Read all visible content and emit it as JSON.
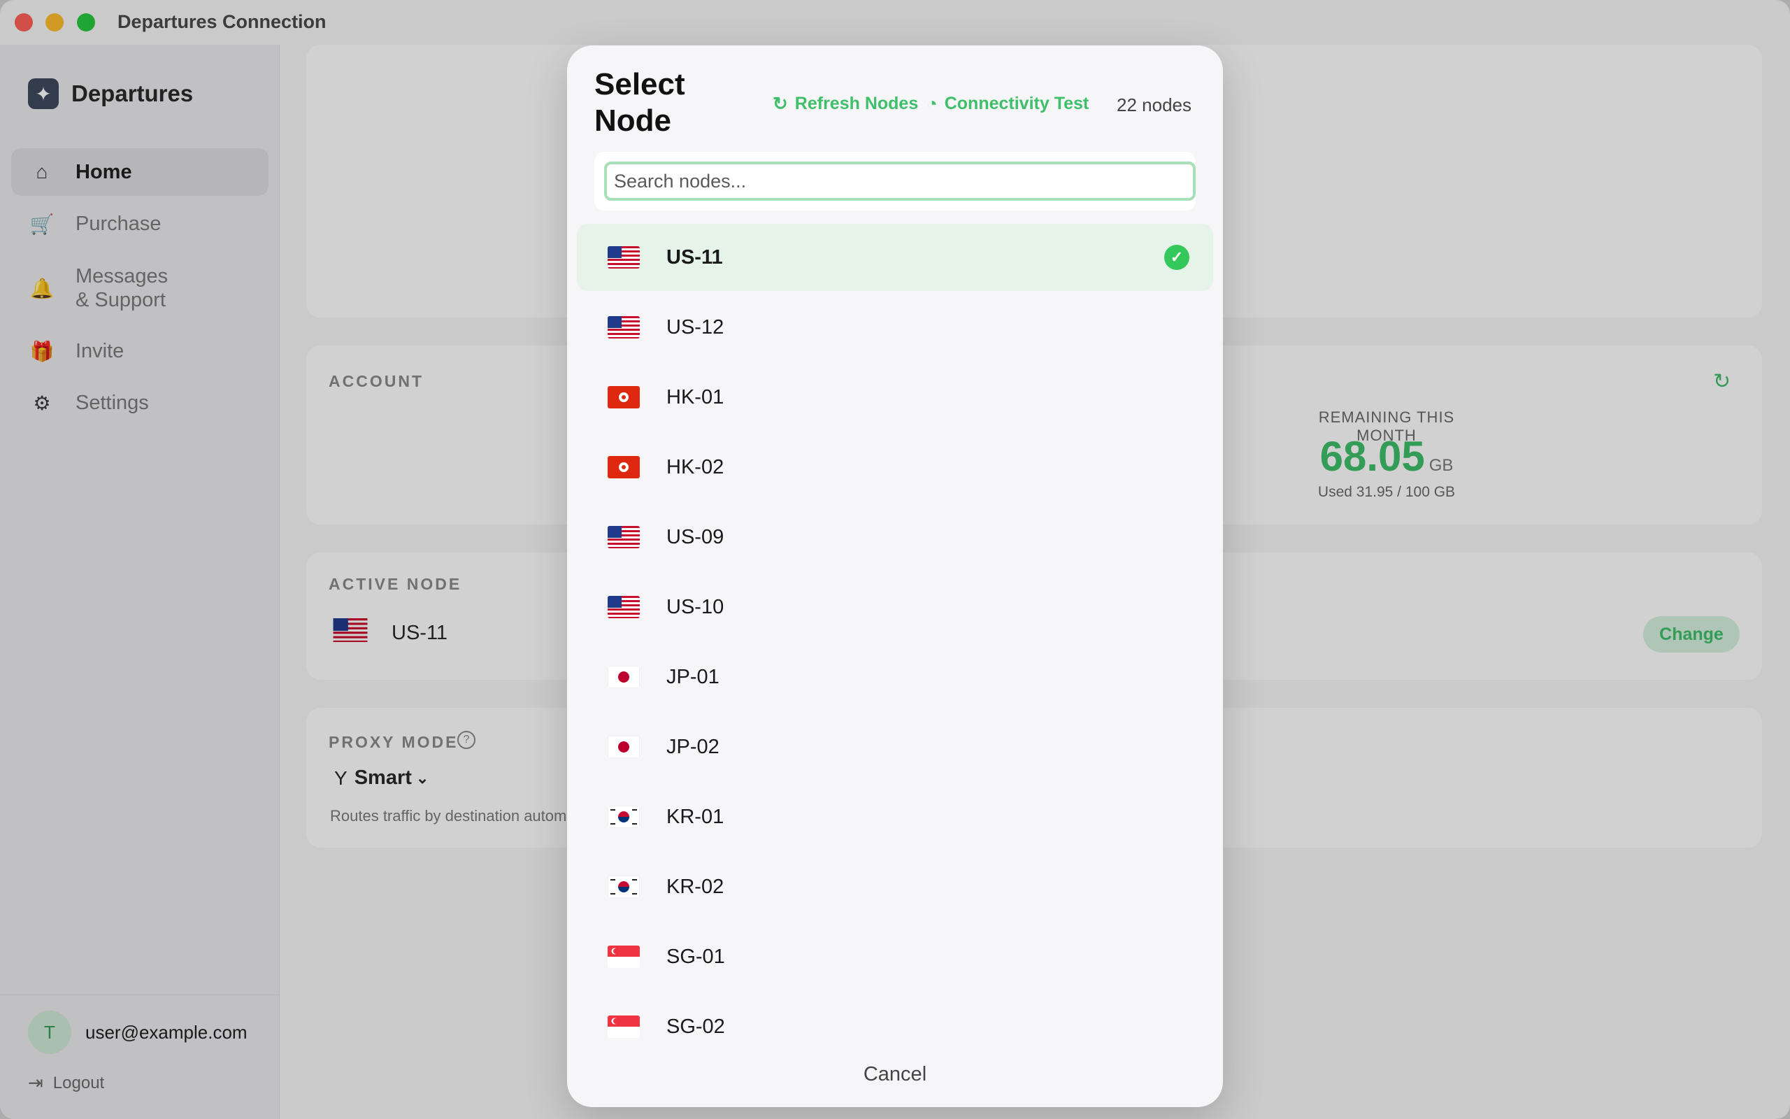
{
  "window": {
    "title": "Departures Connection"
  },
  "sidebar": {
    "brand": "Departures",
    "items": [
      {
        "label": "Home",
        "icon": "house-icon"
      },
      {
        "label": "Purchase",
        "icon": "cart-icon"
      },
      {
        "label": "Messages\n& Support",
        "icon": "bell-icon"
      },
      {
        "label": "Invite",
        "icon": "gift-icon"
      },
      {
        "label": "Settings",
        "icon": "gear-icon"
      }
    ],
    "user": {
      "avatar_letter": "T",
      "email": "user@example.com"
    },
    "logout_label": "Logout"
  },
  "account": {
    "label": "ACCOUNT",
    "remaining_label": "REMAINING THIS MONTH",
    "remaining_value": "68.05",
    "remaining_unit": "GB",
    "used_text": "Used 31.95 / 100 GB"
  },
  "active_node": {
    "label": "ACTIVE NODE",
    "name": "US-11",
    "change_label": "Change"
  },
  "proxy_mode": {
    "label": "PROXY MODE",
    "value": "Smart",
    "description": "Routes traffic by destination automatically"
  },
  "modal": {
    "title": "Select Node",
    "refresh_label": "Refresh Nodes",
    "test_label": "Connectivity Test",
    "count_label": "22 nodes",
    "search_placeholder": "Search nodes...",
    "nodes": [
      {
        "name": "US-11",
        "country": "US",
        "selected": true
      },
      {
        "name": "US-12",
        "country": "US"
      },
      {
        "name": "HK-01",
        "country": "HK"
      },
      {
        "name": "HK-02",
        "country": "HK"
      },
      {
        "name": "US-09",
        "country": "US"
      },
      {
        "name": "US-10",
        "country": "US"
      },
      {
        "name": "JP-01",
        "country": "JP"
      },
      {
        "name": "JP-02",
        "country": "JP"
      },
      {
        "name": "KR-01",
        "country": "KR"
      },
      {
        "name": "KR-02",
        "country": "KR"
      },
      {
        "name": "SG-01",
        "country": "SG"
      },
      {
        "name": "SG-02",
        "country": "SG"
      }
    ],
    "cancel_label": "Cancel"
  },
  "colors": {
    "accent": "#3fbf6a",
    "check": "#34c759",
    "selected_row": "#e6f3e9"
  }
}
